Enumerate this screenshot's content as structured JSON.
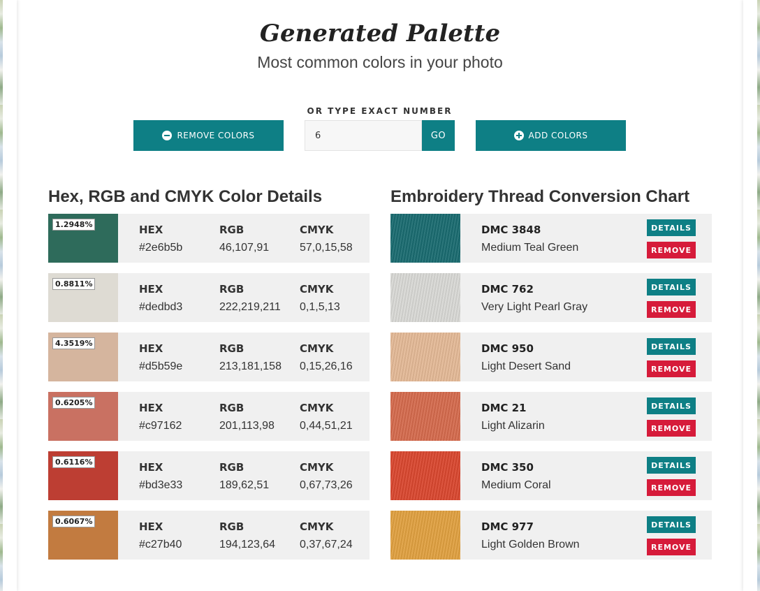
{
  "header": {
    "title": "Generated Palette",
    "subtitle": "Most common colors in your photo"
  },
  "controls": {
    "remove_label": "REMOVE COLORS",
    "exact_label": "OR TYPE EXACT NUMBER",
    "number_value": "6",
    "go_label": "GO",
    "add_label": "ADD COLORS"
  },
  "sections": {
    "color_details": "Hex, RGB and CMYK Color Details",
    "thread_chart": "Embroidery Thread Conversion Chart"
  },
  "labels": {
    "hex": "HEX",
    "rgb": "RGB",
    "cmyk": "CMYK"
  },
  "colors": [
    {
      "pct": "1.2948%",
      "hex": "#2e6b5b",
      "rgb": "46,107,91",
      "cmyk": "57,0,15,58"
    },
    {
      "pct": "0.8811%",
      "hex": "#dedbd3",
      "rgb": "222,219,211",
      "cmyk": "0,1,5,13"
    },
    {
      "pct": "4.3519%",
      "hex": "#d5b59e",
      "rgb": "213,181,158",
      "cmyk": "0,15,26,16"
    },
    {
      "pct": "0.6205%",
      "hex": "#c97162",
      "rgb": "201,113,98",
      "cmyk": "0,44,51,21"
    },
    {
      "pct": "0.6116%",
      "hex": "#bd3e33",
      "rgb": "189,62,51",
      "cmyk": "0,67,73,26"
    },
    {
      "pct": "0.6067%",
      "hex": "#c27b40",
      "rgb": "194,123,64",
      "cmyk": "0,37,67,24"
    }
  ],
  "threads": [
    {
      "code": "DMC 3848",
      "name": "Medium Teal Green",
      "color": "#1a6b70"
    },
    {
      "code": "DMC 762",
      "name": "Very Light Pearl Gray",
      "color": "#d8d8d5"
    },
    {
      "code": "DMC 950",
      "name": "Light Desert Sand",
      "color": "#e3b996"
    },
    {
      "code": "DMC 21",
      "name": "Light Alizarin",
      "color": "#d46a4d"
    },
    {
      "code": "DMC 350",
      "name": "Medium Coral",
      "color": "#d9472f"
    },
    {
      "code": "DMC 977",
      "name": "Light Golden Brown",
      "color": "#e0a040"
    }
  ],
  "thread_buttons": {
    "details": "DETAILS",
    "remove": "REMOVE"
  }
}
